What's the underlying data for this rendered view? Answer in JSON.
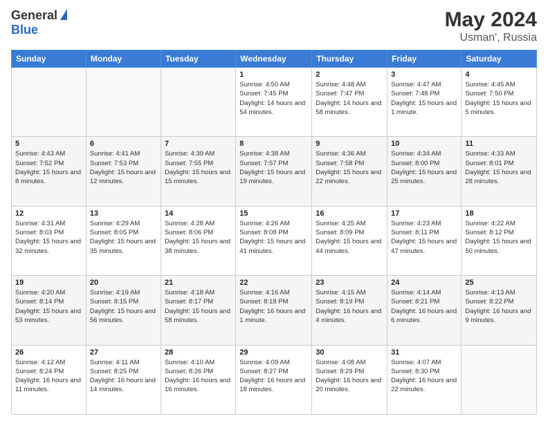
{
  "header": {
    "logo": {
      "general": "General",
      "blue": "Blue"
    },
    "title": "May 2024",
    "subtitle": "Usman', Russia"
  },
  "weekdays": [
    "Sunday",
    "Monday",
    "Tuesday",
    "Wednesday",
    "Thursday",
    "Friday",
    "Saturday"
  ],
  "weeks": [
    [
      {
        "day": "",
        "sunrise": "",
        "sunset": "",
        "daylight": ""
      },
      {
        "day": "",
        "sunrise": "",
        "sunset": "",
        "daylight": ""
      },
      {
        "day": "",
        "sunrise": "",
        "sunset": "",
        "daylight": ""
      },
      {
        "day": "1",
        "sunrise": "Sunrise: 4:50 AM",
        "sunset": "Sunset: 7:45 PM",
        "daylight": "Daylight: 14 hours and 54 minutes."
      },
      {
        "day": "2",
        "sunrise": "Sunrise: 4:48 AM",
        "sunset": "Sunset: 7:47 PM",
        "daylight": "Daylight: 14 hours and 58 minutes."
      },
      {
        "day": "3",
        "sunrise": "Sunrise: 4:47 AM",
        "sunset": "Sunset: 7:48 PM",
        "daylight": "Daylight: 15 hours and 1 minute."
      },
      {
        "day": "4",
        "sunrise": "Sunrise: 4:45 AM",
        "sunset": "Sunset: 7:50 PM",
        "daylight": "Daylight: 15 hours and 5 minutes."
      }
    ],
    [
      {
        "day": "5",
        "sunrise": "Sunrise: 4:43 AM",
        "sunset": "Sunset: 7:52 PM",
        "daylight": "Daylight: 15 hours and 8 minutes."
      },
      {
        "day": "6",
        "sunrise": "Sunrise: 4:41 AM",
        "sunset": "Sunset: 7:53 PM",
        "daylight": "Daylight: 15 hours and 12 minutes."
      },
      {
        "day": "7",
        "sunrise": "Sunrise: 4:39 AM",
        "sunset": "Sunset: 7:55 PM",
        "daylight": "Daylight: 15 hours and 15 minutes."
      },
      {
        "day": "8",
        "sunrise": "Sunrise: 4:38 AM",
        "sunset": "Sunset: 7:57 PM",
        "daylight": "Daylight: 15 hours and 19 minutes."
      },
      {
        "day": "9",
        "sunrise": "Sunrise: 4:36 AM",
        "sunset": "Sunset: 7:58 PM",
        "daylight": "Daylight: 15 hours and 22 minutes."
      },
      {
        "day": "10",
        "sunrise": "Sunrise: 4:34 AM",
        "sunset": "Sunset: 8:00 PM",
        "daylight": "Daylight: 15 hours and 25 minutes."
      },
      {
        "day": "11",
        "sunrise": "Sunrise: 4:33 AM",
        "sunset": "Sunset: 8:01 PM",
        "daylight": "Daylight: 15 hours and 28 minutes."
      }
    ],
    [
      {
        "day": "12",
        "sunrise": "Sunrise: 4:31 AM",
        "sunset": "Sunset: 8:03 PM",
        "daylight": "Daylight: 15 hours and 32 minutes."
      },
      {
        "day": "13",
        "sunrise": "Sunrise: 4:29 AM",
        "sunset": "Sunset: 8:05 PM",
        "daylight": "Daylight: 15 hours and 35 minutes."
      },
      {
        "day": "14",
        "sunrise": "Sunrise: 4:28 AM",
        "sunset": "Sunset: 8:06 PM",
        "daylight": "Daylight: 15 hours and 38 minutes."
      },
      {
        "day": "15",
        "sunrise": "Sunrise: 4:26 AM",
        "sunset": "Sunset: 8:08 PM",
        "daylight": "Daylight: 15 hours and 41 minutes."
      },
      {
        "day": "16",
        "sunrise": "Sunrise: 4:25 AM",
        "sunset": "Sunset: 8:09 PM",
        "daylight": "Daylight: 15 hours and 44 minutes."
      },
      {
        "day": "17",
        "sunrise": "Sunrise: 4:23 AM",
        "sunset": "Sunset: 8:11 PM",
        "daylight": "Daylight: 15 hours and 47 minutes."
      },
      {
        "day": "18",
        "sunrise": "Sunrise: 4:22 AM",
        "sunset": "Sunset: 8:12 PM",
        "daylight": "Daylight: 15 hours and 50 minutes."
      }
    ],
    [
      {
        "day": "19",
        "sunrise": "Sunrise: 4:20 AM",
        "sunset": "Sunset: 8:14 PM",
        "daylight": "Daylight: 15 hours and 53 minutes."
      },
      {
        "day": "20",
        "sunrise": "Sunrise: 4:19 AM",
        "sunset": "Sunset: 8:15 PM",
        "daylight": "Daylight: 15 hours and 56 minutes."
      },
      {
        "day": "21",
        "sunrise": "Sunrise: 4:18 AM",
        "sunset": "Sunset: 8:17 PM",
        "daylight": "Daylight: 15 hours and 58 minutes."
      },
      {
        "day": "22",
        "sunrise": "Sunrise: 4:16 AM",
        "sunset": "Sunset: 8:18 PM",
        "daylight": "Daylight: 16 hours and 1 minute."
      },
      {
        "day": "23",
        "sunrise": "Sunrise: 4:15 AM",
        "sunset": "Sunset: 8:19 PM",
        "daylight": "Daylight: 16 hours and 4 minutes."
      },
      {
        "day": "24",
        "sunrise": "Sunrise: 4:14 AM",
        "sunset": "Sunset: 8:21 PM",
        "daylight": "Daylight: 16 hours and 6 minutes."
      },
      {
        "day": "25",
        "sunrise": "Sunrise: 4:13 AM",
        "sunset": "Sunset: 8:22 PM",
        "daylight": "Daylight: 16 hours and 9 minutes."
      }
    ],
    [
      {
        "day": "26",
        "sunrise": "Sunrise: 4:12 AM",
        "sunset": "Sunset: 8:24 PM",
        "daylight": "Daylight: 16 hours and 11 minutes."
      },
      {
        "day": "27",
        "sunrise": "Sunrise: 4:11 AM",
        "sunset": "Sunset: 8:25 PM",
        "daylight": "Daylight: 16 hours and 14 minutes."
      },
      {
        "day": "28",
        "sunrise": "Sunrise: 4:10 AM",
        "sunset": "Sunset: 8:26 PM",
        "daylight": "Daylight: 16 hours and 16 minutes."
      },
      {
        "day": "29",
        "sunrise": "Sunrise: 4:09 AM",
        "sunset": "Sunset: 8:27 PM",
        "daylight": "Daylight: 16 hours and 18 minutes."
      },
      {
        "day": "30",
        "sunrise": "Sunrise: 4:08 AM",
        "sunset": "Sunset: 8:29 PM",
        "daylight": "Daylight: 16 hours and 20 minutes."
      },
      {
        "day": "31",
        "sunrise": "Sunrise: 4:07 AM",
        "sunset": "Sunset: 8:30 PM",
        "daylight": "Daylight: 16 hours and 22 minutes."
      },
      {
        "day": "",
        "sunrise": "",
        "sunset": "",
        "daylight": ""
      }
    ]
  ]
}
